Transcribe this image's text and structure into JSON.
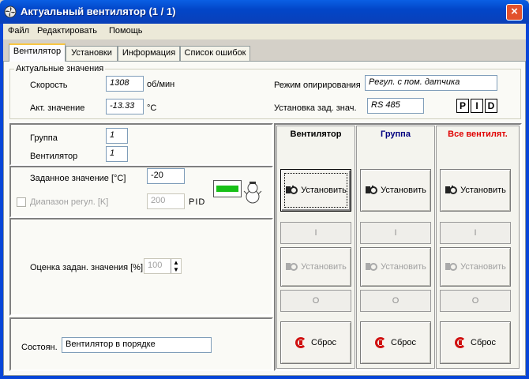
{
  "window": {
    "title": "Актуальный вентилятор (1 / 1)",
    "close_glyph": "×"
  },
  "menu": {
    "items": [
      "Файл",
      "Редактировать",
      "Помощь"
    ]
  },
  "tabs": [
    "Вентилятор",
    "Установки",
    "Информация",
    "Список ошибок"
  ],
  "actual": {
    "legend": "Актуальные значения",
    "speed_label": "Скорость",
    "speed_value": "1308",
    "speed_unit": "об/мин",
    "actual_label": "Акт. значение",
    "actual_value": "-13.33",
    "actual_unit": "°C",
    "mode_label": "Режим опирирования",
    "mode_value": "Регул. с пом. датчика",
    "setpoint_label": "Установка зад. знач.",
    "setpoint_value": "RS 485",
    "pid": [
      "P",
      "I",
      "D"
    ]
  },
  "left": {
    "group_label": "Группа",
    "group_value": "1",
    "fan_label": "Вентилятор",
    "fan_value": "1",
    "target_label": "Заданное значение [°C]",
    "target_value": "-20",
    "range_label": "Диапазон регул. [K]",
    "range_value": "200",
    "range_pid": "PID",
    "estimate_label": "Оценка задан. значения [%]",
    "estimate_value": "100",
    "status_label": "Состоян.",
    "status_value": "Вентилятор в порядке"
  },
  "columns": [
    {
      "header": "Вентилятор",
      "color": "#000000",
      "set_label": "Установить",
      "i_label": "I",
      "set2_label": "Установить",
      "o_label": "O",
      "reset_label": "Сброс"
    },
    {
      "header": "Группа",
      "color": "#000080",
      "set_label": "Установить",
      "i_label": "I",
      "set2_label": "Установить",
      "o_label": "O",
      "reset_label": "Сброс"
    },
    {
      "header": "Все вентилят.",
      "color": "#E00000",
      "set_label": "Установить",
      "i_label": "I",
      "set2_label": "Установить",
      "o_label": "O",
      "reset_label": "Сброс"
    }
  ],
  "icons": {
    "app": "fan-app-icon",
    "status": "snowman-icon",
    "indicator": "green-led-icon",
    "set": "gear-fan-icon",
    "reset": "reset-icon"
  }
}
